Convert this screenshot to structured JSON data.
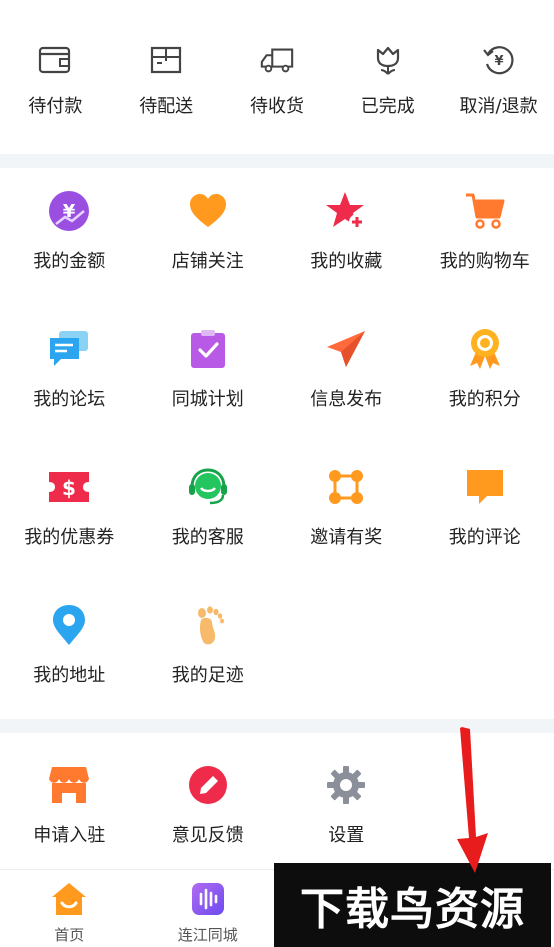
{
  "orders": [
    {
      "label": "待付款",
      "icon": "wallet-icon"
    },
    {
      "label": "待配送",
      "icon": "package-icon"
    },
    {
      "label": "待收货",
      "icon": "truck-icon"
    },
    {
      "label": "已完成",
      "icon": "tulip-icon"
    },
    {
      "label": "取消/退款",
      "icon": "refund-icon"
    }
  ],
  "services": [
    {
      "label": "我的金额",
      "icon": "yuan-coin-icon"
    },
    {
      "label": "店铺关注",
      "icon": "heart-icon"
    },
    {
      "label": "我的收藏",
      "icon": "star-plus-icon"
    },
    {
      "label": "我的购物车",
      "icon": "cart-icon"
    },
    {
      "label": "我的论坛",
      "icon": "chat-bubbles-icon"
    },
    {
      "label": "同城计划",
      "icon": "clipboard-check-icon"
    },
    {
      "label": "信息发布",
      "icon": "paper-plane-icon"
    },
    {
      "label": "我的积分",
      "icon": "medal-icon"
    },
    {
      "label": "我的优惠券",
      "icon": "coupon-icon"
    },
    {
      "label": "我的客服",
      "icon": "headset-icon"
    },
    {
      "label": "邀请有奖",
      "icon": "nodes-icon"
    },
    {
      "label": "我的评论",
      "icon": "comment-icon"
    },
    {
      "label": "我的地址",
      "icon": "location-pin-icon"
    },
    {
      "label": "我的足迹",
      "icon": "footprint-icon"
    }
  ],
  "tools": [
    {
      "label": "申请入驻",
      "icon": "shop-icon"
    },
    {
      "label": "意见反馈",
      "icon": "pencil-icon"
    },
    {
      "label": "设置",
      "icon": "gear-icon"
    }
  ],
  "tabbar": {
    "items": [
      {
        "label": "首页",
        "icon": "home-icon"
      },
      {
        "label": "连江同城",
        "icon": "voice-icon"
      }
    ]
  },
  "watermark": {
    "text": "下载鸟资源"
  },
  "colors": {
    "separator": "#f2f5f8",
    "purple": "#9b4fe0",
    "orange": "#ff9a1f",
    "red": "#ef2b4b",
    "blue": "#2ba5ef",
    "green": "#22c55e",
    "arrow": "#e81c1c"
  }
}
